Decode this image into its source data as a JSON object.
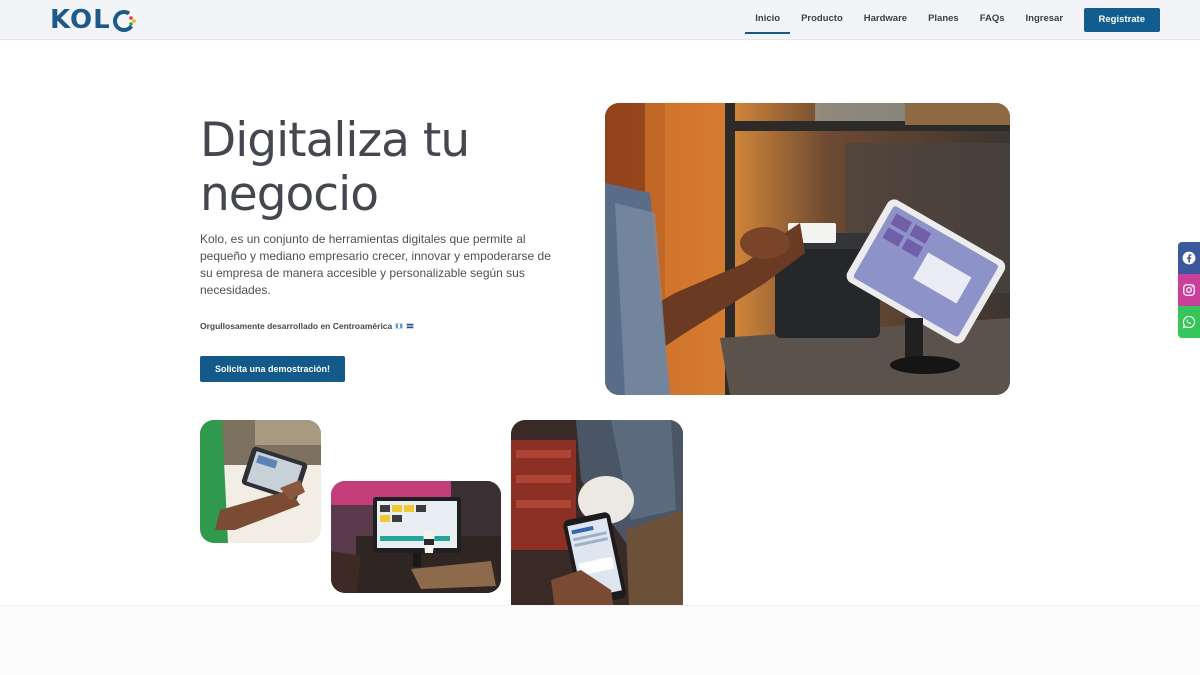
{
  "header": {
    "logo_text": "KOLO",
    "nav": {
      "inicio": "Inicio",
      "producto": "Producto",
      "hardware": "Hardware",
      "planes": "Planes",
      "faqs": "FAQs",
      "ingresar": "Ingresar",
      "registrate": "Registrate"
    },
    "active_item": "Inicio"
  },
  "hero": {
    "title_line1": "Digitaliza tu",
    "title_line2": "negocio",
    "description": "Kolo, es un conjunto de herramientas digitales que permite al pequeño y mediano empresario crecer, innovar y empoderarse de su empresa de manera accesible y personalizable según sus necesidades.",
    "proud_text": "Orgullosamente desarrollado en Centroamérica",
    "cta_label": "Solicita una demostración!"
  },
  "photos": {
    "main": "pos-receipt-printer-tablet-photo",
    "tablet": "handheld-tablet-photo",
    "monitor": "counter-monitor-photo",
    "phone": "smartphone-app-photo"
  },
  "social": {
    "icons": [
      "facebook-icon",
      "instagram-icon",
      "whatsapp-icon"
    ]
  },
  "colors": {
    "brand_blue": "#125d8f",
    "logo_blue": "#1c5a8c",
    "header_bg": "#f3f4f7",
    "title_color": "#444750",
    "facebook": "#3a589b",
    "instagram": "#c93f9a",
    "whatsapp": "#35c55a"
  }
}
